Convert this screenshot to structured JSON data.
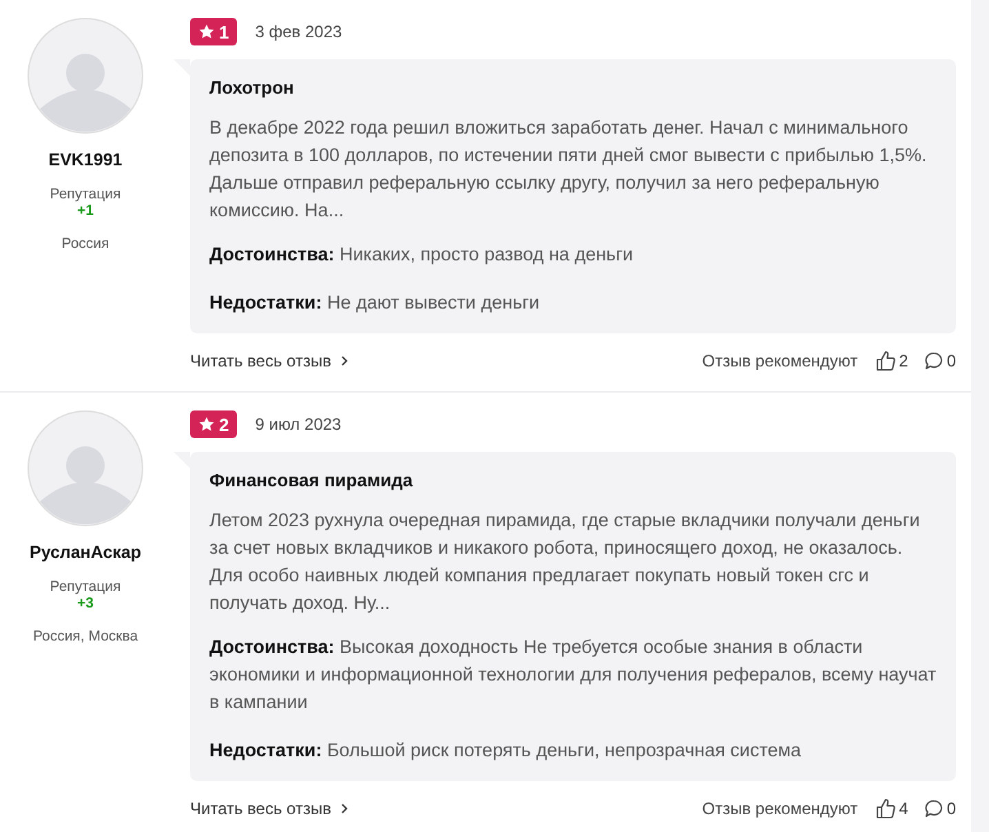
{
  "reviews": [
    {
      "author": "EVK1991",
      "reputation_label": "Репутация",
      "reputation": "+1",
      "location": "Россия",
      "rating": "1",
      "date": "3 фев 2023",
      "title": "Лохотрон",
      "text": "В декабре 2022 года решил вложиться заработать денег. Начал с минимального депозита в 100 долларов, по истечении пяти дней смог вывести с прибылью 1,5%. Дальше отправил реферальную ссылку другу, получил за него реферальную комиссию. На...",
      "pros": "**Достоинства:** Никаких, просто развод на деньги",
      "cons": "**Недостатки:** Не дают вывести деньги",
      "read_more": "Читать весь отзыв",
      "recommend_label": "Отзыв рекомендуют",
      "likes": "2",
      "comments": "0"
    },
    {
      "author": "РусланАскар",
      "reputation_label": "Репутация",
      "reputation": "+3",
      "location": "Россия, Москва",
      "rating": "2",
      "date": "9 июл 2023",
      "title": "Финансовая пирамида",
      "text": "Летом 2023 рухнула очередная пирамида, где старые вкладчики получали деньги за счет новых вкладчиков и никакого робота, приносящего доход, не оказалось. Для особо наивных людей компания предлагает покупать новый токен сгс и получать доход. Ну...",
      "pros": "**Достоинства:** Высокая доходность Не требуется особые знания в области экономики и информационной технологии для получения рефералов, всему научат в кампании",
      "cons": "**Недостатки:** Большой риск потерять деньги, непрозрачная система",
      "read_more": "Читать весь отзыв",
      "recommend_label": "Отзыв рекомендуют",
      "likes": "4",
      "comments": "0"
    }
  ]
}
